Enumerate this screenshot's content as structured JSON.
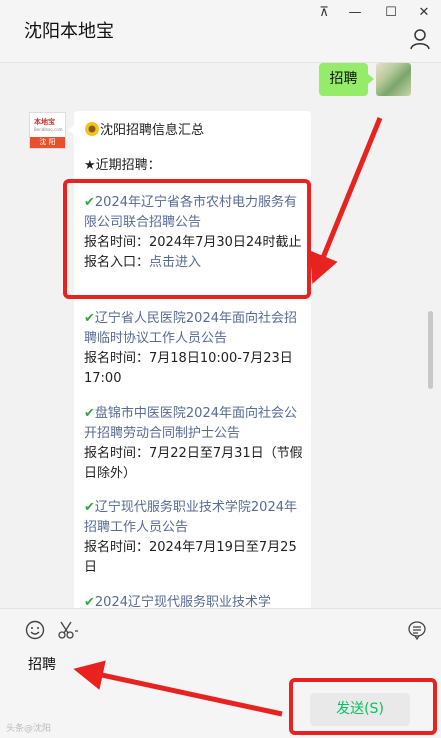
{
  "window": {
    "title": "沈阳本地宝",
    "controls": [
      "⊼",
      "—",
      "☐",
      "✕"
    ]
  },
  "chat": {
    "my_message": "招聘",
    "other_avatar": {
      "top": "本地宝",
      "mid": "Bendibao.com",
      "bottom": "沈 阳"
    },
    "card": {
      "header_icon": "sunflower-emoji",
      "header": "沈阳招聘信息汇总",
      "recent_label": "★近期招聘：",
      "items": [
        {
          "title": "2024年辽宁省各市农村电力服务有限公司联合招聘公告",
          "time": "报名时间：2024年7月30日24时截止",
          "entry_label": "报名入口：",
          "entry_link": "点击进入"
        },
        {
          "title": "辽宁省人民医院2024年面向社会招聘临时协议工作人员公告",
          "time": "报名时间：7月18日10:00-7月23日17:00"
        },
        {
          "title": "盘锦市中医医院2024年面向社会公开招聘劳动合同制护士公告",
          "time": "报名时间：7月22日至7月31日（节假日除外）"
        },
        {
          "title": "辽宁现代服务职业技术学院2024年招聘工作人员公告",
          "time": "报名时间：2024年7月19日至7月25日"
        },
        {
          "title": "2024辽宁现代服务职业技术学"
        }
      ]
    }
  },
  "input": {
    "text": "招聘",
    "send_label": "发送(S)",
    "watermark": "头条@沈阳"
  },
  "colors": {
    "accent_green": "#95ec69",
    "link": "#576b95",
    "annotation_red": "#e8231f",
    "send_text": "#07c160"
  }
}
